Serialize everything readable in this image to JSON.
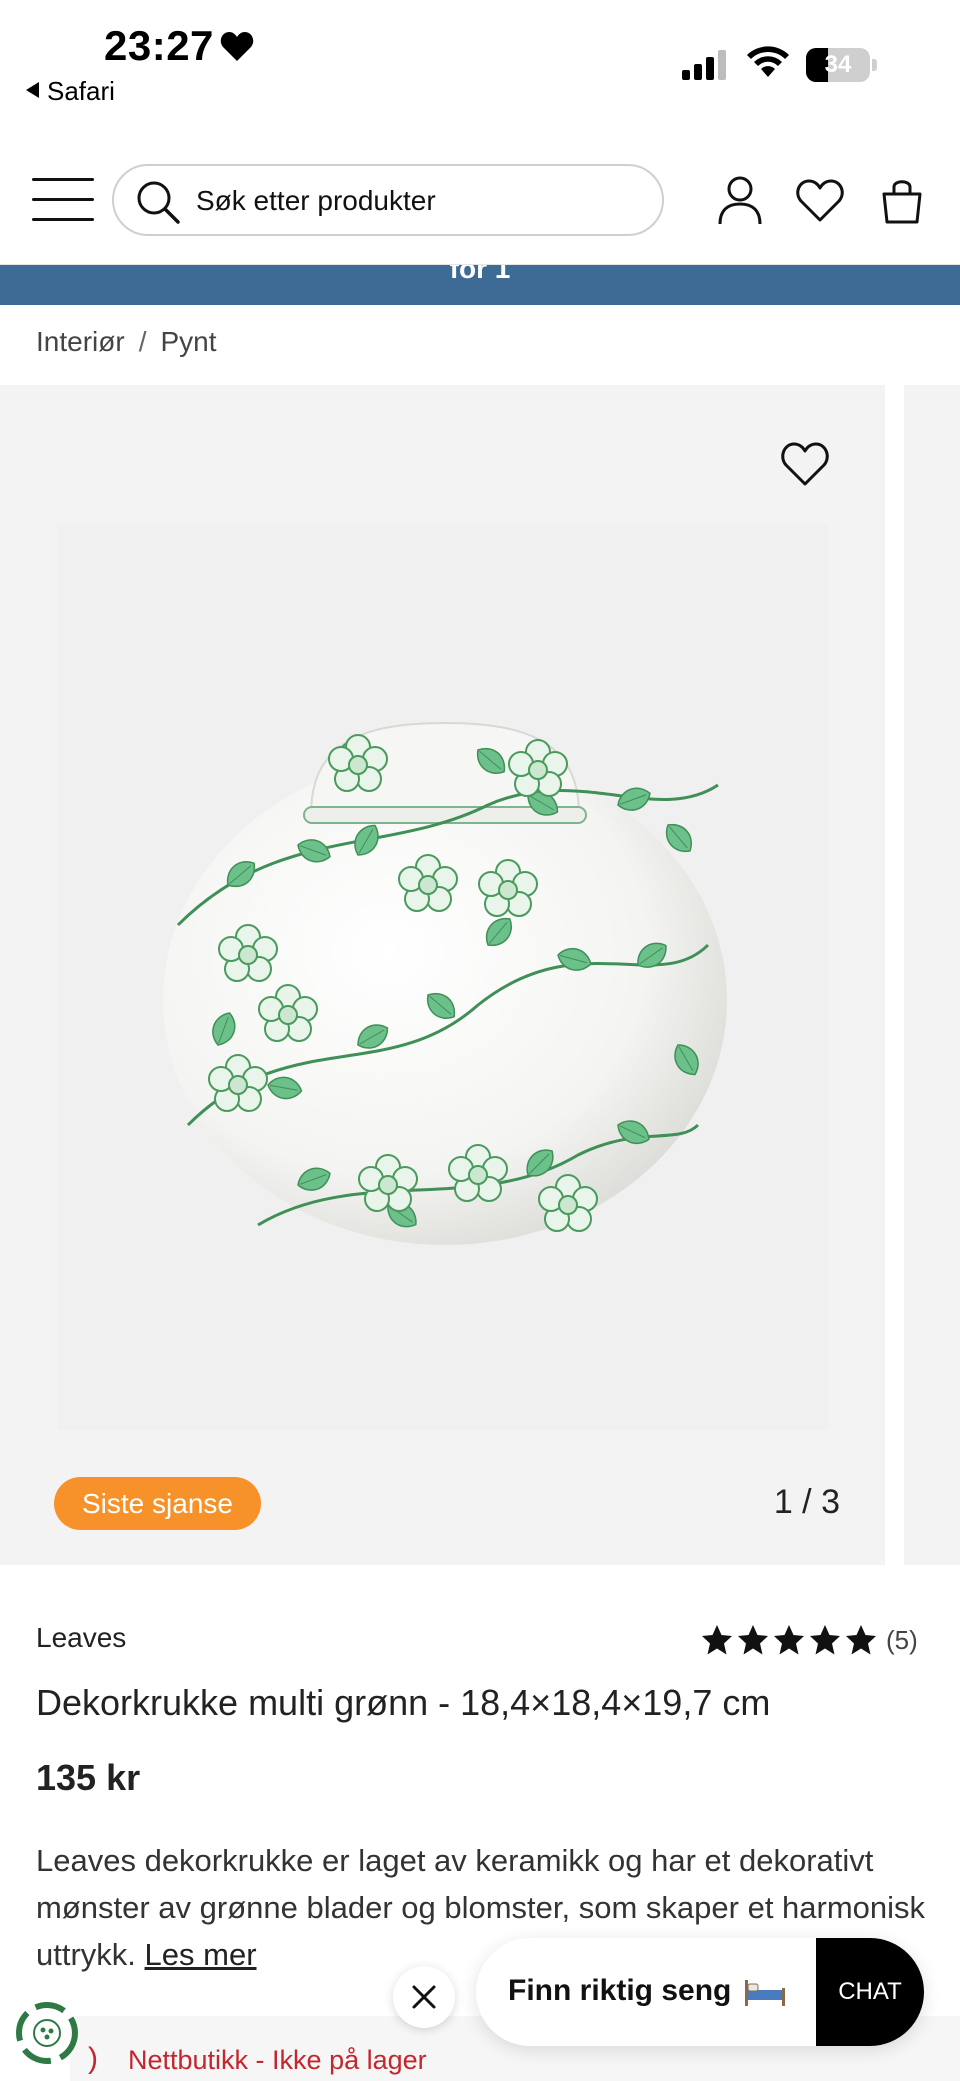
{
  "status_bar": {
    "time": "23:27",
    "back_app": "Safari",
    "battery_level": "34",
    "battery_fraction": 0.34
  },
  "header": {
    "search_placeholder": "Søk etter produkter",
    "icons": [
      "menu-icon",
      "search-icon",
      "user-icon",
      "heart-icon",
      "cart-icon"
    ]
  },
  "promo": {
    "text": "for 1"
  },
  "breadcrumb": {
    "items": [
      "Interiør",
      "Pynt"
    ],
    "separator": "/"
  },
  "gallery": {
    "badge": "Siste sjanse",
    "counter": "1 / 3",
    "badge_color": "#f7922b"
  },
  "product": {
    "brand": "Leaves",
    "rating_stars": 5,
    "rating_count": "(5)",
    "title": "Dekorkrukke multi grønn - 18,4×18,4×19,7 cm",
    "price": "135 kr",
    "description": "Leaves dekorkrukke er laget av keramikk og har et dekorativt mønster av grønne blader og blomster, som skaper et harmonisk uttrykk.",
    "read_more": "Les mer",
    "stock_status": "Nettbutikk - Ikke på lager"
  },
  "chat_widget": {
    "prompt": "Finn riktig seng",
    "button": "CHAT"
  },
  "colors": {
    "promo_bar": "#3e6b96",
    "badge": "#f7922b",
    "stock_warning": "#c4262e",
    "pattern_green": "#4caf6a"
  }
}
